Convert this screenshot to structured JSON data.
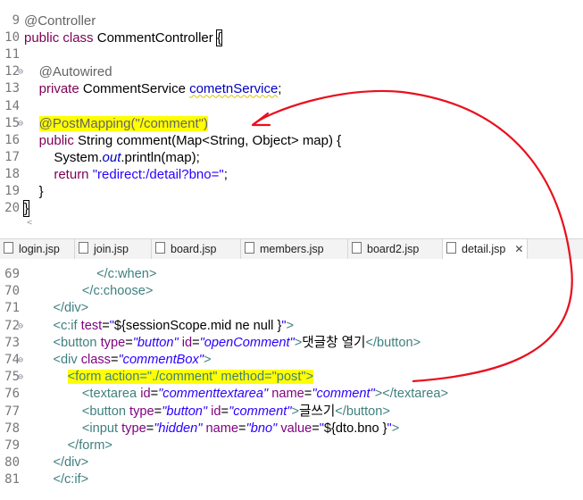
{
  "java_editor": {
    "lines": [
      {
        "num": "9",
        "segments": [
          {
            "t": "@Controller",
            "c": "ann"
          }
        ]
      },
      {
        "num": "10",
        "segments": [
          {
            "t": "public",
            "c": "kw"
          },
          {
            "t": " "
          },
          {
            "t": "class",
            "c": "kw"
          },
          {
            "t": " CommentController "
          },
          {
            "t": "{",
            "c": "cursor-box"
          }
        ]
      },
      {
        "num": "11",
        "segments": []
      },
      {
        "num": "12",
        "fold": true,
        "segments": [
          {
            "t": "    "
          },
          {
            "t": "@Autowired",
            "c": "ann"
          }
        ]
      },
      {
        "num": "13",
        "segments": [
          {
            "t": "    "
          },
          {
            "t": "private",
            "c": "kw"
          },
          {
            "t": " CommentService "
          },
          {
            "t": "cometnService",
            "c": "fld squig"
          },
          {
            "t": ";"
          }
        ]
      },
      {
        "num": "14",
        "segments": []
      },
      {
        "num": "15",
        "fold": true,
        "segments": [
          {
            "t": "    "
          },
          {
            "t": "@PostMapping(\"/comment\")",
            "c": "ann hl"
          }
        ]
      },
      {
        "num": "16",
        "segments": [
          {
            "t": "    "
          },
          {
            "t": "public",
            "c": "kw"
          },
          {
            "t": " String comment(Map<String, Object> map) {"
          }
        ]
      },
      {
        "num": "17",
        "segments": [
          {
            "t": "        System."
          },
          {
            "t": "out",
            "c": "fld ital"
          },
          {
            "t": ".println(map);"
          }
        ]
      },
      {
        "num": "18",
        "segments": [
          {
            "t": "        "
          },
          {
            "t": "return",
            "c": "kw"
          },
          {
            "t": " "
          },
          {
            "t": "\"redirect:/detail?bno=\"",
            "c": "str"
          },
          {
            "t": ";"
          }
        ]
      },
      {
        "num": "19",
        "segments": [
          {
            "t": "    }"
          }
        ]
      },
      {
        "num": "20",
        "segments": [
          {
            "t": "}",
            "c": "cursor-box"
          }
        ]
      }
    ]
  },
  "tabs": [
    {
      "label": "login.jsp",
      "active": false
    },
    {
      "label": "join.jsp",
      "active": false
    },
    {
      "label": "board.jsp",
      "active": false
    },
    {
      "label": "members.jsp",
      "active": false
    },
    {
      "label": "board2.jsp",
      "active": false
    },
    {
      "label": "detail.jsp",
      "active": true,
      "close": "✕"
    }
  ],
  "jsp_editor": {
    "lines": [
      {
        "num": "69",
        "segments": [
          {
            "t": "                    "
          },
          {
            "t": "</c:when>",
            "c": "tag"
          }
        ]
      },
      {
        "num": "70",
        "segments": [
          {
            "t": "                "
          },
          {
            "t": "</c:choose>",
            "c": "tag"
          }
        ]
      },
      {
        "num": "71",
        "segments": [
          {
            "t": "        "
          },
          {
            "t": "</div>",
            "c": "tag"
          }
        ]
      },
      {
        "num": "72",
        "fold": true,
        "segments": [
          {
            "t": "        "
          },
          {
            "t": "<c:if",
            "c": "tag"
          },
          {
            "t": " "
          },
          {
            "t": "test",
            "c": "attr"
          },
          {
            "t": "="
          },
          {
            "t": "\"",
            "c": "jval"
          },
          {
            "t": "${sessionScope.mid ne null }"
          },
          {
            "t": "\"",
            "c": "jval"
          },
          {
            "t": ">",
            "c": "tag"
          }
        ]
      },
      {
        "num": "73",
        "segments": [
          {
            "t": "        "
          },
          {
            "t": "<button",
            "c": "tag"
          },
          {
            "t": " "
          },
          {
            "t": "type",
            "c": "attr"
          },
          {
            "t": "="
          },
          {
            "t": "\"button\"",
            "c": "aval"
          },
          {
            "t": " "
          },
          {
            "t": "id",
            "c": "attr"
          },
          {
            "t": "="
          },
          {
            "t": "\"openComment\"",
            "c": "aval"
          },
          {
            "t": ">",
            "c": "tag"
          },
          {
            "t": "댓글창 열기"
          },
          {
            "t": "</button>",
            "c": "tag"
          }
        ]
      },
      {
        "num": "74",
        "fold": true,
        "segments": [
          {
            "t": "        "
          },
          {
            "t": "<div",
            "c": "tag"
          },
          {
            "t": " "
          },
          {
            "t": "class",
            "c": "attr"
          },
          {
            "t": "="
          },
          {
            "t": "\"commentBox\"",
            "c": "aval"
          },
          {
            "t": ">",
            "c": "tag"
          }
        ]
      },
      {
        "num": "75",
        "fold": true,
        "segments": [
          {
            "t": "            "
          },
          {
            "t": "<form action=\"./comment\" method=\"post\">",
            "c": "tag hl"
          }
        ]
      },
      {
        "num": "76",
        "segments": [
          {
            "t": "                "
          },
          {
            "t": "<textarea",
            "c": "tag"
          },
          {
            "t": " "
          },
          {
            "t": "id",
            "c": "attr"
          },
          {
            "t": "="
          },
          {
            "t": "\"commenttextarea\"",
            "c": "aval"
          },
          {
            "t": " "
          },
          {
            "t": "name",
            "c": "attr"
          },
          {
            "t": "="
          },
          {
            "t": "\"comment\"",
            "c": "aval"
          },
          {
            "t": "></textarea>",
            "c": "tag"
          }
        ]
      },
      {
        "num": "77",
        "segments": [
          {
            "t": "                "
          },
          {
            "t": "<button",
            "c": "tag"
          },
          {
            "t": " "
          },
          {
            "t": "type",
            "c": "attr"
          },
          {
            "t": "="
          },
          {
            "t": "\"button\"",
            "c": "aval"
          },
          {
            "t": " "
          },
          {
            "t": "id",
            "c": "attr"
          },
          {
            "t": "="
          },
          {
            "t": "\"comment\"",
            "c": "aval"
          },
          {
            "t": ">",
            "c": "tag"
          },
          {
            "t": "글쓰기"
          },
          {
            "t": "</button>",
            "c": "tag"
          }
        ]
      },
      {
        "num": "78",
        "segments": [
          {
            "t": "                "
          },
          {
            "t": "<input",
            "c": "tag"
          },
          {
            "t": " "
          },
          {
            "t": "type",
            "c": "attr"
          },
          {
            "t": "="
          },
          {
            "t": "\"hidden\"",
            "c": "aval"
          },
          {
            "t": " "
          },
          {
            "t": "name",
            "c": "attr"
          },
          {
            "t": "="
          },
          {
            "t": "\"bno\"",
            "c": "aval"
          },
          {
            "t": " "
          },
          {
            "t": "value",
            "c": "attr"
          },
          {
            "t": "="
          },
          {
            "t": "\"",
            "c": "jval"
          },
          {
            "t": "${dto.bno }"
          },
          {
            "t": "\"",
            "c": "jval"
          },
          {
            "t": ">",
            "c": "tag"
          }
        ]
      },
      {
        "num": "79",
        "segments": [
          {
            "t": "            "
          },
          {
            "t": "</form>",
            "c": "tag"
          }
        ]
      },
      {
        "num": "80",
        "segments": [
          {
            "t": "        "
          },
          {
            "t": "</div>",
            "c": "tag"
          }
        ]
      },
      {
        "num": "81",
        "segments": [
          {
            "t": "        "
          },
          {
            "t": "</c:if>",
            "c": "tag"
          }
        ]
      }
    ]
  },
  "colors": {
    "highlight": "#ffff00",
    "arrow": "#e8101e",
    "keyword": "#7f0055",
    "annotation": "#646464",
    "tag": "#3f7f7f",
    "attribute": "#7f007f",
    "string": "#2a00ff"
  }
}
